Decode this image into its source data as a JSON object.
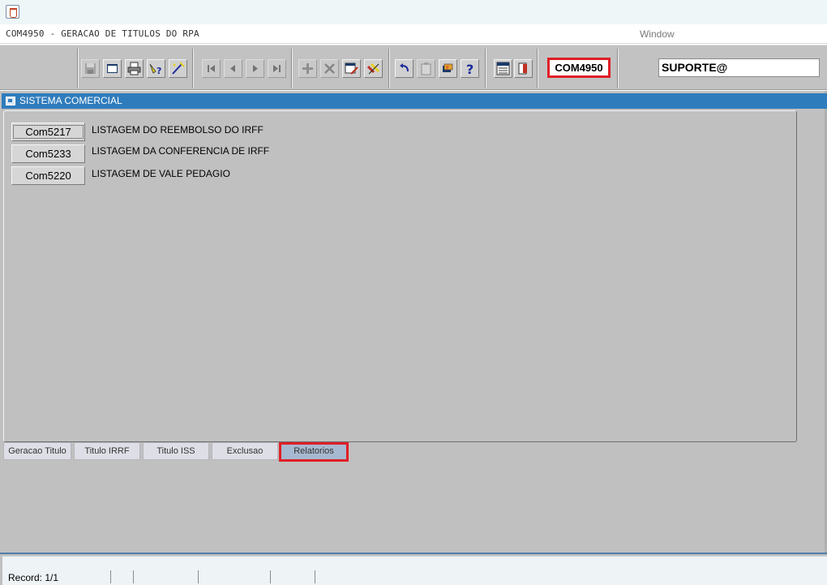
{
  "titlebar": {
    "icon": "java-cup-icon"
  },
  "menubar": {
    "form_title": "COM4950 - GERACAO DE TITULOS DO RPA",
    "window_menu": "Window"
  },
  "toolbar": {
    "icons": [
      "save-icon",
      "window-icon",
      "print-icon",
      "query-help-icon",
      "wizard-icon",
      "first-record-icon",
      "previous-record-icon",
      "next-record-icon",
      "last-record-icon",
      "insert-record-icon",
      "delete-record-icon",
      "edit-record-icon",
      "clear-icon",
      "undo-icon",
      "clipboard-icon",
      "hand-icon",
      "help-icon",
      "menu-icon",
      "exit-icon"
    ],
    "form_code": "COM4950",
    "user": "SUPORTE@"
  },
  "window": {
    "title": "SISTEMA COMERCIAL",
    "reports": [
      {
        "button": "Com5217",
        "description": "LISTAGEM DO REEMBOLSO DO IRFF"
      },
      {
        "button": "Com5233",
        "description": "LISTAGEM DA CONFERENCIA DE IRFF"
      },
      {
        "button": "Com5220",
        "description": "LISTAGEM DE VALE PEDAGIO"
      }
    ],
    "tabs": [
      "Geracao Titulo",
      "Titulo IRRF",
      "Titulo ISS",
      "Exclusao",
      "Relatorios"
    ],
    "active_tab": "Relatorios"
  },
  "status": {
    "record": "Record: 1/1"
  },
  "colors": {
    "window_title_bg": "#2f7cbd",
    "highlight": "#e01e26",
    "active_tab_bg": "#a7b9d0"
  }
}
